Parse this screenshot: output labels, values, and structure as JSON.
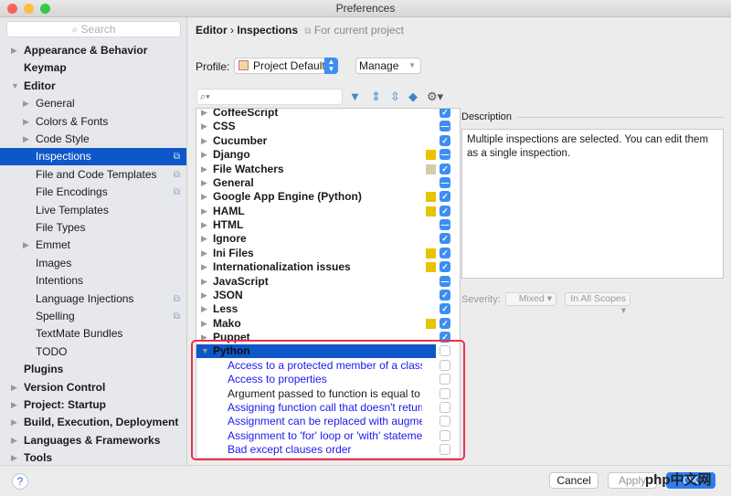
{
  "window": {
    "title": "Preferences"
  },
  "sidebar": {
    "search_placeholder": "Search",
    "items": [
      {
        "label": "Appearance & Behavior",
        "level": 0,
        "bold": true,
        "arrow": "right"
      },
      {
        "label": "Keymap",
        "level": 0,
        "bold": true,
        "arrow": ""
      },
      {
        "label": "Editor",
        "level": 0,
        "bold": true,
        "arrow": "down"
      },
      {
        "label": "General",
        "level": 1,
        "arrow": "right"
      },
      {
        "label": "Colors & Fonts",
        "level": 1,
        "arrow": "right"
      },
      {
        "label": "Code Style",
        "level": 1,
        "arrow": "right"
      },
      {
        "label": "Inspections",
        "level": 1,
        "arrow": "",
        "selected": true,
        "project_icon": true
      },
      {
        "label": "File and Code Templates",
        "level": 1,
        "arrow": "",
        "project_icon": true
      },
      {
        "label": "File Encodings",
        "level": 1,
        "arrow": "",
        "project_icon": true
      },
      {
        "label": "Live Templates",
        "level": 1,
        "arrow": ""
      },
      {
        "label": "File Types",
        "level": 1,
        "arrow": ""
      },
      {
        "label": "Emmet",
        "level": 1,
        "arrow": "right"
      },
      {
        "label": "Images",
        "level": 1,
        "arrow": ""
      },
      {
        "label": "Intentions",
        "level": 1,
        "arrow": ""
      },
      {
        "label": "Language Injections",
        "level": 1,
        "arrow": "",
        "project_icon": true
      },
      {
        "label": "Spelling",
        "level": 1,
        "arrow": "",
        "project_icon": true
      },
      {
        "label": "TextMate Bundles",
        "level": 1,
        "arrow": ""
      },
      {
        "label": "TODO",
        "level": 1,
        "arrow": ""
      },
      {
        "label": "Plugins",
        "level": 0,
        "bold": true,
        "arrow": ""
      },
      {
        "label": "Version Control",
        "level": 0,
        "bold": true,
        "arrow": "right"
      },
      {
        "label": "Project: Startup",
        "level": 0,
        "bold": true,
        "arrow": "right"
      },
      {
        "label": "Build, Execution, Deployment",
        "level": 0,
        "bold": true,
        "arrow": "right"
      },
      {
        "label": "Languages & Frameworks",
        "level": 0,
        "bold": true,
        "arrow": "right"
      },
      {
        "label": "Tools",
        "level": 0,
        "bold": true,
        "arrow": "right"
      }
    ]
  },
  "breadcrumb": {
    "parent": "Editor",
    "separator": "›",
    "current": "Inspections",
    "scope": "For current project"
  },
  "profile": {
    "label": "Profile:",
    "value": "Project Default",
    "manage": "Manage"
  },
  "tree": {
    "items": [
      {
        "label": "CoffeeScript",
        "state": "check"
      },
      {
        "label": "CSS",
        "state": "mixed"
      },
      {
        "label": "Cucumber",
        "state": "check"
      },
      {
        "label": "Django",
        "state": "mixed",
        "severity_color": "#e8c300"
      },
      {
        "label": "File Watchers",
        "state": "check",
        "severity_color": "#d6cca8"
      },
      {
        "label": "General",
        "state": "mixed"
      },
      {
        "label": "Google App Engine (Python)",
        "state": "check",
        "severity_color": "#e8c300"
      },
      {
        "label": "HAML",
        "state": "check",
        "severity_color": "#e8c300"
      },
      {
        "label": "HTML",
        "state": "mixed"
      },
      {
        "label": "Ignore",
        "state": "check"
      },
      {
        "label": "Ini Files",
        "state": "check",
        "severity_color": "#e8c300"
      },
      {
        "label": "Internationalization issues",
        "state": "check",
        "severity_color": "#e8c300"
      },
      {
        "label": "JavaScript",
        "state": "mixed"
      },
      {
        "label": "JSON",
        "state": "check"
      },
      {
        "label": "Less",
        "state": "check"
      },
      {
        "label": "Mako",
        "state": "check",
        "severity_color": "#e8c300"
      },
      {
        "label": "Puppet",
        "state": "check"
      },
      {
        "label": "Python",
        "state": "unchecked",
        "expanded": true,
        "selected": true
      },
      {
        "label": "Access to a protected member of a class",
        "state": "unchecked",
        "child": true
      },
      {
        "label": "Access to properties",
        "state": "unchecked",
        "child": true
      },
      {
        "label": "Argument passed to function is equal to default",
        "state": "unchecked",
        "child": true,
        "plain": true
      },
      {
        "label": "Assigning function call that doesn't return anything",
        "state": "unchecked",
        "child": true
      },
      {
        "label": "Assignment can be replaced with augmented assignment",
        "state": "unchecked",
        "child": true
      },
      {
        "label": "Assignment to 'for' loop or 'with' statement parameter",
        "state": "unchecked",
        "child": true
      },
      {
        "label": "Bad except clauses order",
        "state": "unchecked",
        "child": true
      }
    ]
  },
  "description": {
    "heading": "Description",
    "text": "Multiple inspections are selected. You can edit them as a single inspection."
  },
  "severity": {
    "label": "Severity:",
    "value": "Mixed",
    "scope": "In All Scopes"
  },
  "buttons": {
    "help": "?",
    "cancel": "Cancel",
    "apply": "Apply",
    "ok": "OK"
  },
  "watermark": "php中文网",
  "colors": {
    "selection": "#0e57c9",
    "checkbox": "#3d8ef2",
    "highlight_border": "#e7344d"
  }
}
